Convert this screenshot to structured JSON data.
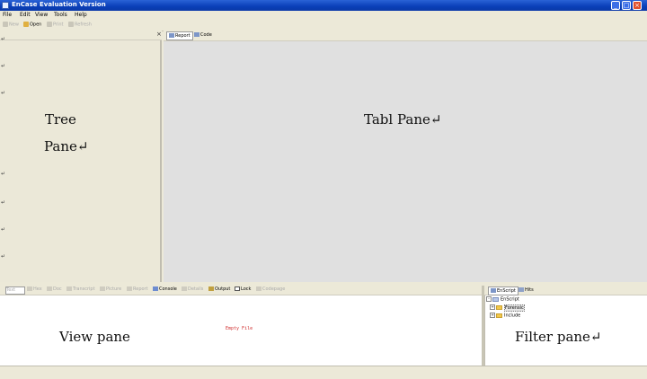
{
  "window": {
    "title": "EnCase Evaluation Version"
  },
  "menu": [
    "File",
    "Edit",
    "View",
    "Tools",
    "Help"
  ],
  "toolbar": {
    "new": "New",
    "open": "Open",
    "print": "Print",
    "refresh": "Refresh"
  },
  "tabs": [
    {
      "label": "Report"
    },
    {
      "label": "Code"
    }
  ],
  "annotations": {
    "tree_line1": "Tree",
    "tree_line2": "Pane↵",
    "tab": "Tabl Pane↵",
    "view": "View pane",
    "filter": "Filter pane↵"
  },
  "paragraph_mark": "↵",
  "view_tabs": [
    {
      "label": "Text",
      "active": false
    },
    {
      "label": "Hex",
      "active": false
    },
    {
      "label": "Doc",
      "active": false
    },
    {
      "label": "Transcript",
      "active": false
    },
    {
      "label": "Picture",
      "active": false
    },
    {
      "label": "Report",
      "active": false
    },
    {
      "label": "Console",
      "active": true
    },
    {
      "label": "Details",
      "active": false
    },
    {
      "label": "Output",
      "active": true
    },
    {
      "label": "Lock",
      "active": true
    },
    {
      "label": "Codepage",
      "active": false
    }
  ],
  "view_content": "Empty File",
  "filter_tabs": [
    {
      "label": "EnScript"
    },
    {
      "label": "Hits"
    }
  ],
  "filter_tree": {
    "root": "EnScript",
    "children": [
      "Forensic",
      "Include"
    ]
  },
  "close_symbol": "×"
}
